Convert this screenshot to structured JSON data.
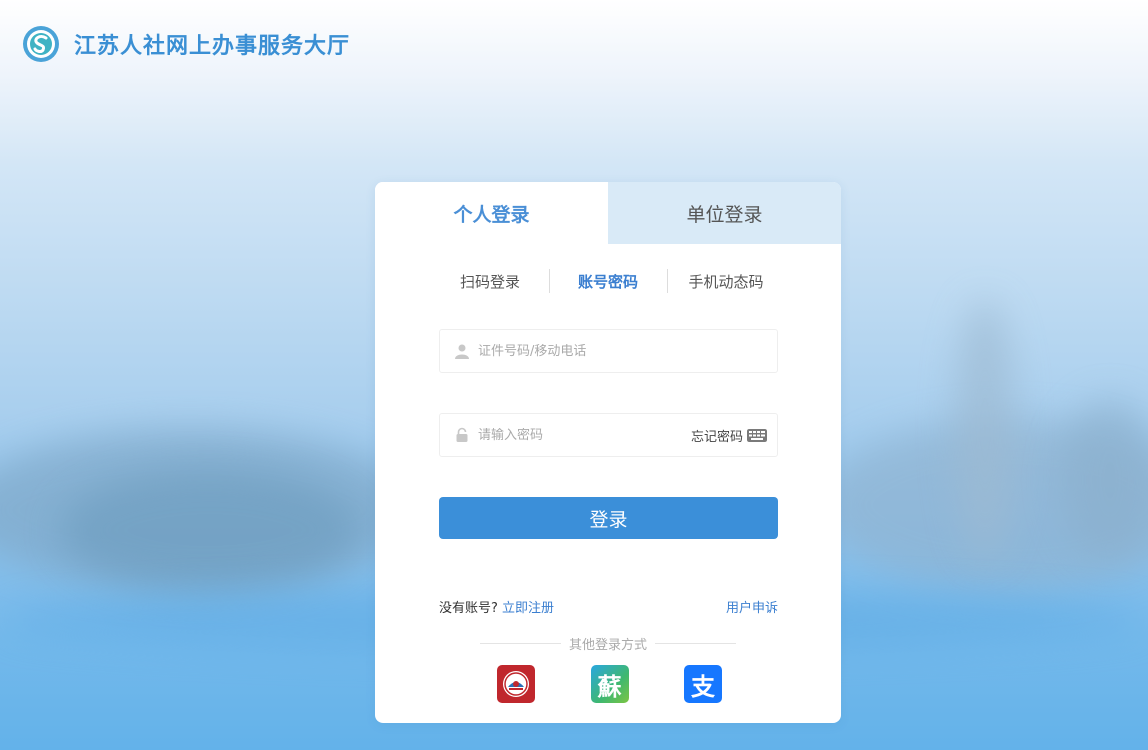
{
  "header": {
    "site_title": "江苏人社网上办事服务大厅"
  },
  "login": {
    "main_tabs": [
      {
        "label": "个人登录",
        "active": true
      },
      {
        "label": "单位登录",
        "active": false
      }
    ],
    "sub_tabs": [
      {
        "label": "扫码登录",
        "active": false
      },
      {
        "label": "账号密码",
        "active": true
      },
      {
        "label": "手机动态码",
        "active": false
      }
    ],
    "id_field": {
      "placeholder": "证件号码/移动电话",
      "value": ""
    },
    "password_field": {
      "placeholder": "请输入密码",
      "value": ""
    },
    "forgot_password": "忘记密码",
    "submit_label": "登录",
    "no_account_text": "没有账号?",
    "register_link": "立即注册",
    "appeal_link": "用户申诉",
    "other_methods_label": "其他登录方式",
    "alt_methods": [
      {
        "name": "hrss-app",
        "icon": "hrss-badge-icon"
      },
      {
        "name": "su-service",
        "icon": "su-character-icon",
        "glyph": "蘇"
      },
      {
        "name": "alipay",
        "icon": "alipay-icon",
        "glyph": "支"
      }
    ]
  },
  "colors": {
    "accent": "#3b8fd9",
    "link": "#3b7fd0",
    "tab_inactive_bg": "#d9eaf7",
    "title": "#3a8fd4"
  }
}
